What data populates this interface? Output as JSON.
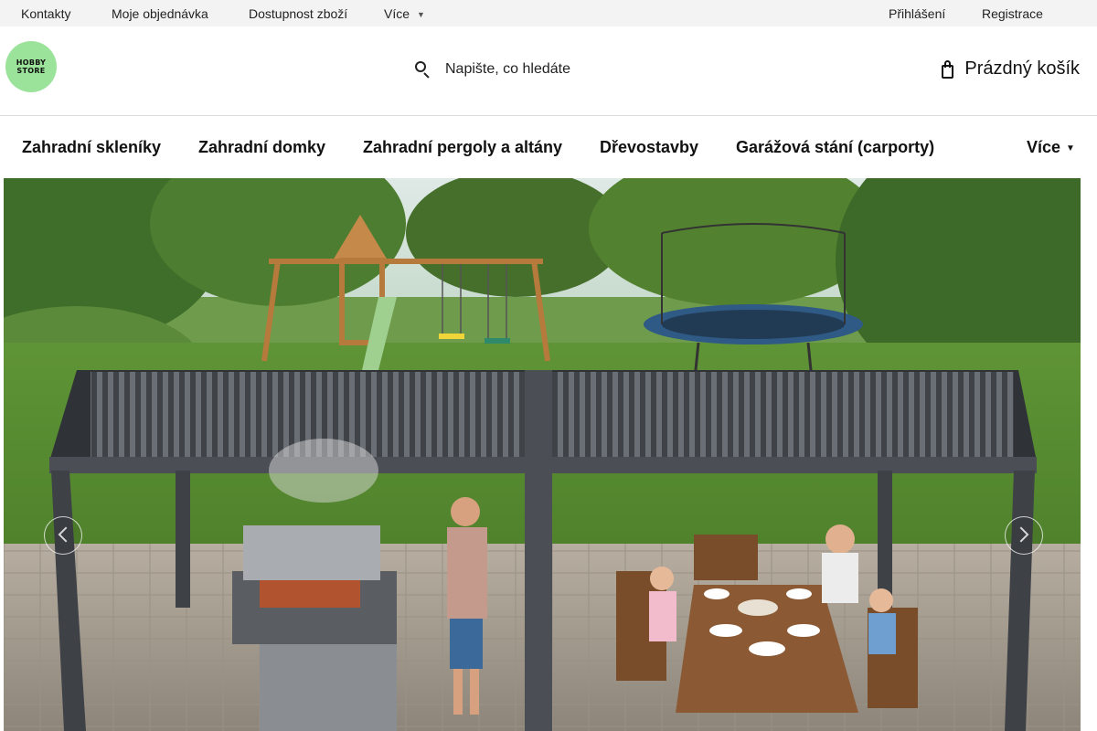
{
  "topbar": {
    "links": [
      "Kontakty",
      "Moje objednávka",
      "Dostupnost zboží",
      "Více"
    ],
    "login": "Přihlášení",
    "register": "Registrace"
  },
  "header": {
    "logo_line1": "HOBBY",
    "logo_line2": "STORE",
    "search_placeholder": "Napište, co hledáte",
    "cart_label": "Prázdný košík"
  },
  "nav": {
    "items": [
      "Zahradní skleníky",
      "Zahradní domky",
      "Zahradní pergoly a altány",
      "Dřevostavby",
      "Garážová stání (carporty)"
    ],
    "more": "Více"
  },
  "colors": {
    "topbar_bg": "#f3f3f3",
    "logo_green": "#9be39a",
    "pergola_gray": "#4b4f55"
  }
}
